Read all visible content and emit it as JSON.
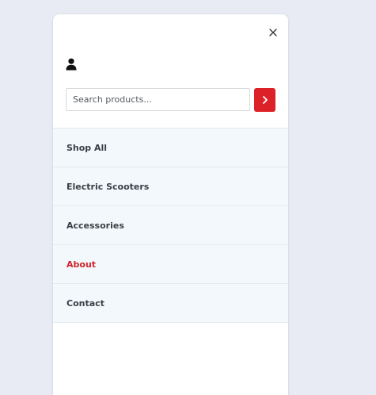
{
  "drawer": {
    "close_icon": "close-icon",
    "account_icon": "user-icon"
  },
  "search": {
    "placeholder": "Search products...",
    "value": "",
    "submit_icon": "chevron-right-icon"
  },
  "menu": {
    "items": [
      {
        "label": "Shop All",
        "active": false
      },
      {
        "label": "Electric Scooters",
        "active": false
      },
      {
        "label": "Accessories",
        "active": false
      },
      {
        "label": "About",
        "active": true
      },
      {
        "label": "Contact",
        "active": false
      }
    ]
  },
  "colors": {
    "background": "#e9ebf4",
    "accent": "#dc2228",
    "menu_background": "#f2f8fb",
    "menu_text": "#3b3f45",
    "active_text": "#d0232b"
  }
}
